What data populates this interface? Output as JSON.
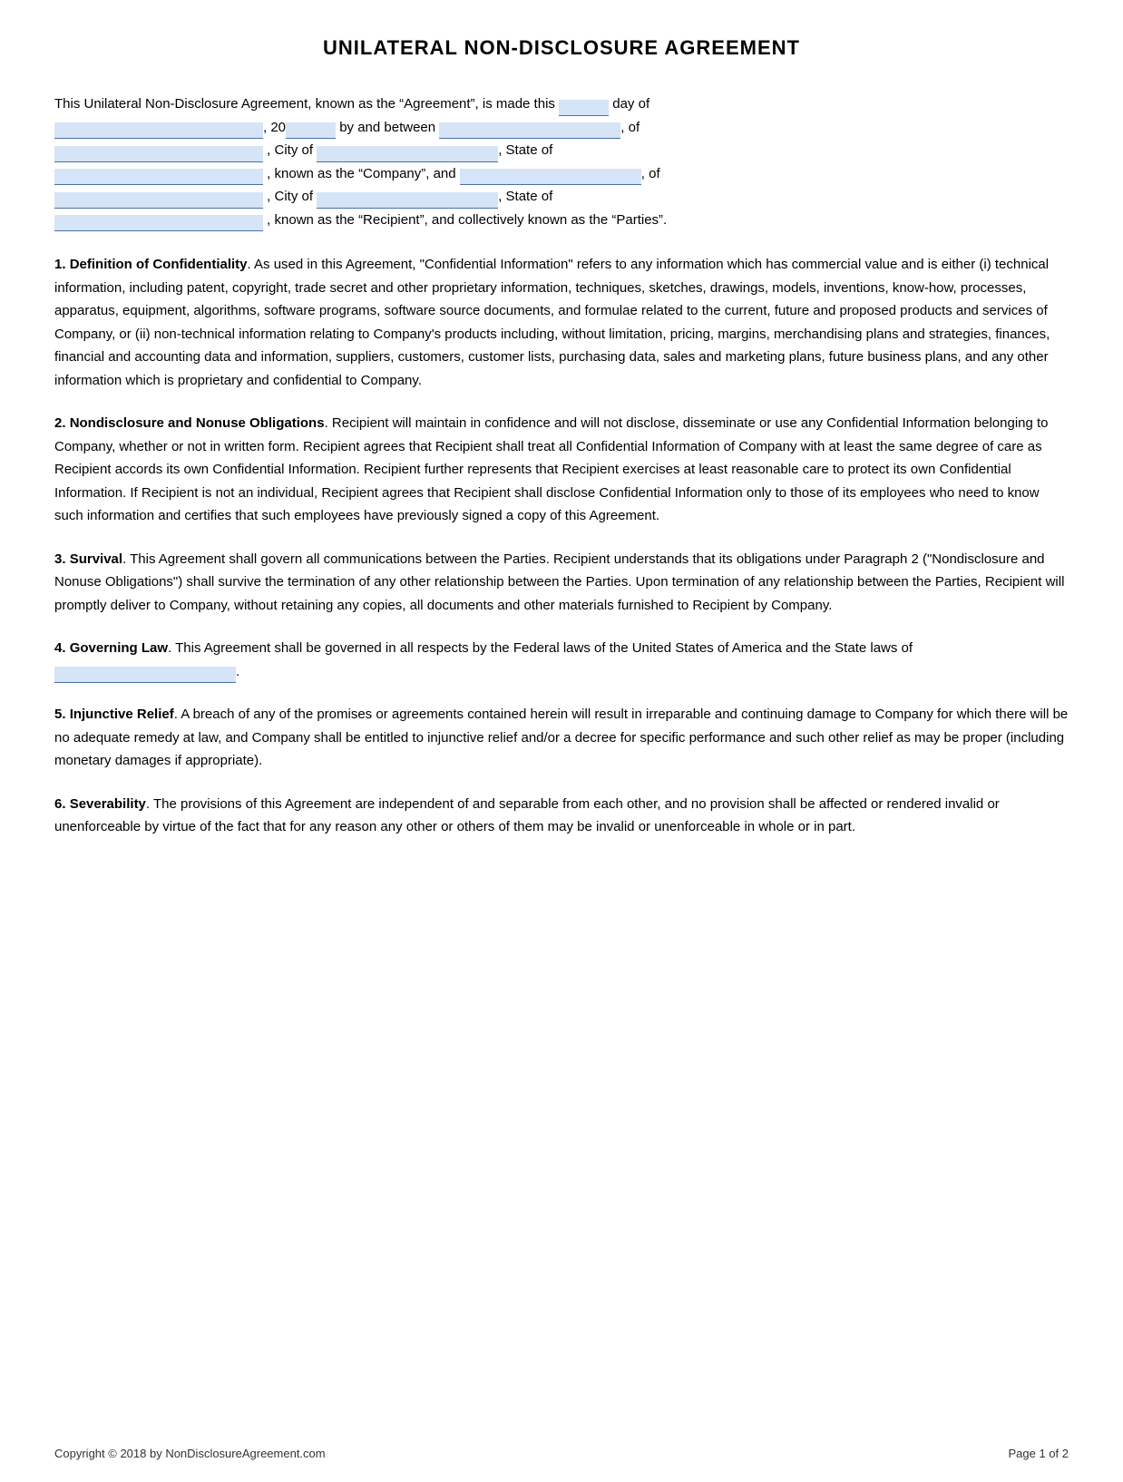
{
  "title": "UNILATERAL NON-DISCLOSURE AGREEMENT",
  "intro": {
    "line1_start": "This Unilateral Non-Disclosure Agreement, known as the “Agreement”, is made this",
    "line1_day": "day of",
    "line1_20": "20",
    "line1_by_and_between": "by and between",
    "line1_of": ", of",
    "line2_city_of": ", City of",
    "line2_state_of": ", State of",
    "line3_known_as_company": ", known as the “Company”, and",
    "line3_of": ", of",
    "line4_city_of": ", City of",
    "line4_state_of": ", State of",
    "line5_known_as_recipient": ", known as the “Recipient”, and collectively known as the “Parties”."
  },
  "sections": [
    {
      "number": "1",
      "title": "Definition of Confidentiality",
      "body": ". As used in this Agreement, \"Confidential Information\" refers to any information which has commercial value and is either (i) technical information, including patent, copyright, trade secret and other proprietary information, techniques, sketches, drawings, models, inventions, know-how, processes, apparatus, equipment, algorithms, software programs, software source documents, and formulae related to the current, future and proposed products and services of Company, or (ii) non-technical information relating to Company's products including, without limitation, pricing, margins, merchandising plans and strategies, finances, financial and accounting data and information, suppliers, customers, customer lists, purchasing data, sales and marketing plans, future business plans, and any other information which is proprietary and confidential to Company."
    },
    {
      "number": "2",
      "title": "Nondisclosure and Nonuse Obligations",
      "body": ". Recipient will maintain in confidence and will not disclose, disseminate or use any Confidential Information belonging to Company, whether or not in written form. Recipient agrees that Recipient shall treat all Confidential Information of Company with at least the same degree of care as Recipient accords its own Confidential Information. Recipient further represents that Recipient exercises at least reasonable care to protect its own Confidential Information. If Recipient is not an individual, Recipient agrees that Recipient shall disclose Confidential Information only to those of its employees who need to know such information and certifies that such employees have previously signed a copy of this Agreement."
    },
    {
      "number": "3",
      "title": "Survival",
      "body": ". This Agreement shall govern all communications between the Parties. Recipient understands that its obligations under Paragraph 2 (\"Nondisclosure and Nonuse Obligations\") shall survive the termination of any other relationship between the Parties. Upon termination of any relationship between the Parties, Recipient will promptly deliver to Company, without retaining any copies, all documents and other materials furnished to Recipient by Company."
    },
    {
      "number": "4",
      "title": "Governing Law",
      "body": ".  This Agreement shall be governed in all respects by the Federal laws of the United States of America and the State laws of"
    },
    {
      "number": "5",
      "title": "Injunctive Relief",
      "body": ".  A breach of any of the promises or agreements contained herein will result in irreparable and continuing damage to Company for which there will be no adequate remedy at law, and Company shall be entitled to injunctive relief and/or a decree for specific performance and such other relief as may be proper (including monetary damages if appropriate)."
    },
    {
      "number": "6",
      "title": "Severability",
      "body": ". The provisions of this Agreement are independent of and separable from each other, and no provision shall be affected or rendered invalid or unenforceable by virtue of the fact that for any reason any other or others of them may be invalid or unenforceable in whole or in part."
    }
  ],
  "footer": {
    "copyright": "Copyright © 2018 by NonDisclosureAgreement.com",
    "page": "Page 1 of 2"
  }
}
